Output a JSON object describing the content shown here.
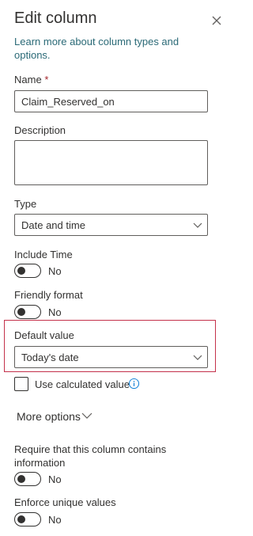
{
  "panel": {
    "title": "Edit column",
    "learn_more": "Learn more about column types and options."
  },
  "name": {
    "label": "Name",
    "required_mark": "*",
    "value": "Claim_Reserved_on"
  },
  "description": {
    "label": "Description",
    "value": ""
  },
  "type": {
    "label": "Type",
    "selected": "Date and time"
  },
  "include_time": {
    "label": "Include Time",
    "state": "No"
  },
  "friendly_format": {
    "label": "Friendly format",
    "state": "No"
  },
  "default_value": {
    "label": "Default value",
    "selected": "Today's date"
  },
  "use_calculated": {
    "label": "Use calculated value"
  },
  "more_options": {
    "label": "More options"
  },
  "require_info": {
    "label": "Require that this column contains information",
    "state": "No"
  },
  "enforce_unique": {
    "label": "Enforce unique values",
    "state": "No"
  },
  "colors": {
    "link": "#2b6a77",
    "highlight_border": "#c4314b",
    "required": "#a4262c",
    "info": "#0078d4"
  },
  "icons": {
    "close": "close-icon",
    "chevron": "chevron-down-icon",
    "info": "info-icon"
  }
}
